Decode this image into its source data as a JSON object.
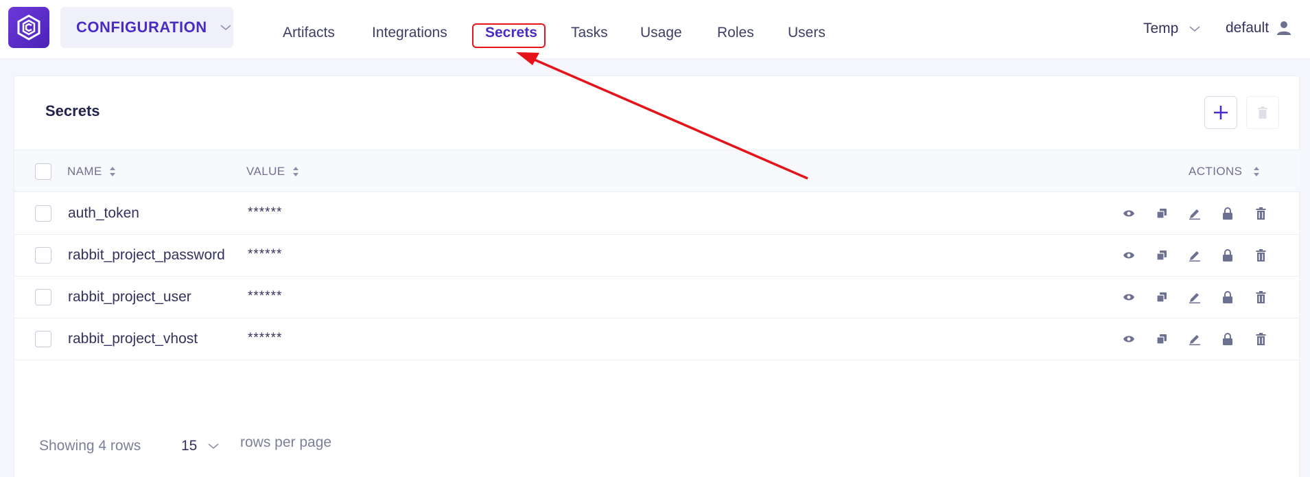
{
  "app": {
    "logo_icon": "configuration-logo-icon",
    "section": {
      "label": "CONFIGURATION",
      "icon": "chevron-down-icon"
    }
  },
  "nav": {
    "items": [
      {
        "label": "Artifacts",
        "active": false
      },
      {
        "label": "Integrations",
        "active": false
      },
      {
        "label": "Secrets",
        "active": true
      },
      {
        "label": "Tasks",
        "active": false
      },
      {
        "label": "Usage",
        "active": false
      },
      {
        "label": "Roles",
        "active": false
      },
      {
        "label": "Users",
        "active": false
      }
    ]
  },
  "header_right": {
    "tenant": "Temp",
    "user": "default",
    "user_icon": "user-icon"
  },
  "page": {
    "title": "Secrets",
    "add_icon": "plus-icon",
    "delete_icon": "trash-icon"
  },
  "table": {
    "columns": {
      "name": "NAME",
      "value": "VALUE",
      "actions": "ACTIONS"
    },
    "rows": [
      {
        "name": "auth_token",
        "value": "******"
      },
      {
        "name": "rabbit_project_password",
        "value": "******"
      },
      {
        "name": "rabbit_project_user",
        "value": "******"
      },
      {
        "name": "rabbit_project_vhost",
        "value": "******"
      }
    ],
    "action_icons": [
      "eye-icon",
      "copy-icon",
      "edit-icon",
      "lock-icon",
      "trash-icon"
    ]
  },
  "footer": {
    "showing": "Showing 4 rows",
    "page_size": "15",
    "rows_per_page": "rows per page"
  },
  "colors": {
    "accent": "#4b2cc2",
    "annotation": "#e5141b",
    "icon": "#6d7191"
  }
}
